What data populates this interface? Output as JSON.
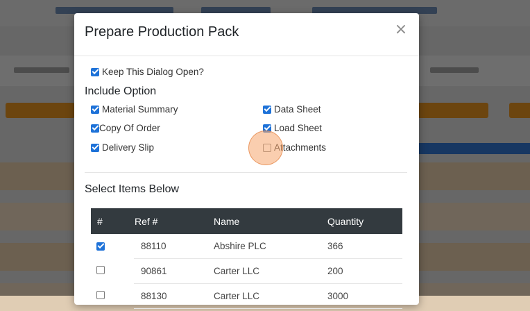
{
  "modal": {
    "title": "Prepare Production Pack",
    "close_icon": "×",
    "keep_open_label": "Keep This Dialog Open?",
    "keep_open_checked": true,
    "include_option_heading": "Include Option",
    "options": [
      {
        "label": "Material Summary",
        "checked": true
      },
      {
        "label": "Data Sheet",
        "checked": true
      },
      {
        "label": "Copy Of Order",
        "checked": true
      },
      {
        "label": "Load Sheet",
        "checked": true
      },
      {
        "label": "Delivery Slip",
        "checked": true
      },
      {
        "label": "Attachments",
        "checked": false
      }
    ],
    "select_items_heading": "Select Items Below",
    "table": {
      "headers": [
        "#",
        "Ref #",
        "Name",
        "Quantity"
      ],
      "rows": [
        {
          "checked": true,
          "ref": "88110",
          "name": "Abshire PLC",
          "quantity": "366"
        },
        {
          "checked": false,
          "ref": "90861",
          "name": "Carter LLC",
          "quantity": "200"
        },
        {
          "checked": false,
          "ref": "88130",
          "name": "Carter LLC",
          "quantity": "3000"
        }
      ]
    }
  },
  "colors": {
    "accent": "#1e72d8",
    "table_header": "#333a3f",
    "cursor_highlight": "#f5a66e"
  }
}
